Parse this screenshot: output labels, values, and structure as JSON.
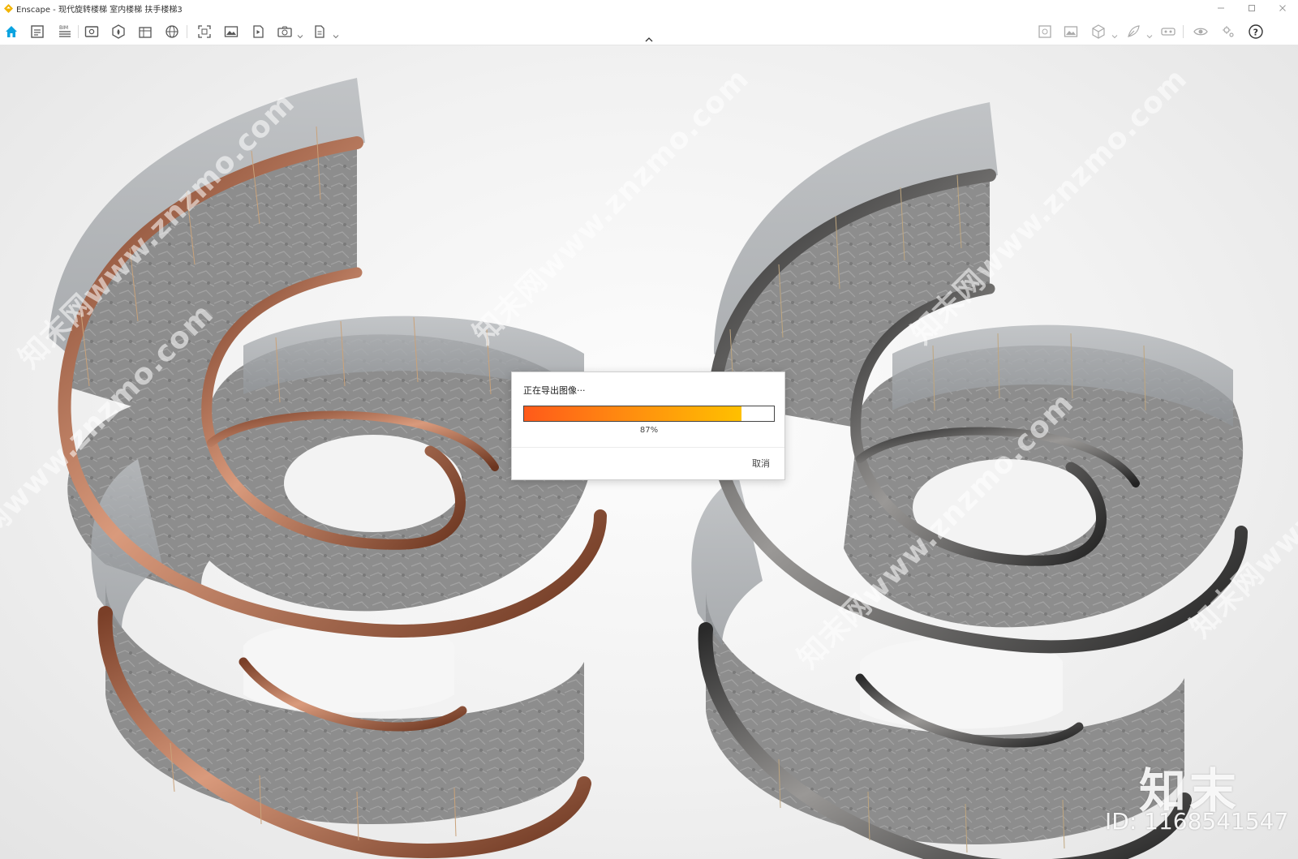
{
  "window": {
    "title": "Enscape - 现代旋转楼梯 室内楼梯 扶手楼梯3",
    "controls": [
      "minimize-icon",
      "maximize-icon",
      "close-icon"
    ]
  },
  "toolbar": {
    "left_icons": [
      "home-icon",
      "file-panel-icon",
      "bim-icon",
      "view-icon",
      "asset-library-icon",
      "material-icon",
      "globe-icon",
      "screenshot-icon",
      "image-icon",
      "video-icon",
      "export-icon",
      "batch-icon"
    ],
    "right_icons": [
      "map-icon",
      "photo-icon",
      "box-icon",
      "feather-icon",
      "vr-headset-icon",
      "visual-settings-icon",
      "settings-icon",
      "help-icon"
    ],
    "accent": "#0aa3e0"
  },
  "scene": {
    "description_colors": {
      "left_rail": "#a5674d",
      "right_rail": "#4a4846",
      "stone": "#8b8b8b",
      "glass": "#c8cccf"
    }
  },
  "watermark": {
    "diagonal": [
      "知末网www.znzmo.com",
      "知末网www.znzmo.com",
      "知末网www.znzmo.com",
      "知末网www.znzmo.com",
      "知末网www.znzmo.com",
      "知末网www"
    ],
    "brand": "知末",
    "id": "ID: 1168541547"
  },
  "dialog": {
    "title": "正在导出图像···",
    "progress": 0.87,
    "progress_label": "87%",
    "cancel_label": "取消",
    "bar_colors": [
      "#ff5a1a",
      "#ffc000"
    ]
  }
}
